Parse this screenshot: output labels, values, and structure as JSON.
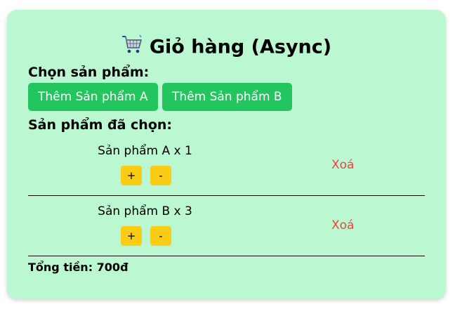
{
  "header": {
    "title": "Giỏ hàng (Async)",
    "icon": "shopping-cart-icon"
  },
  "select_label": "Chọn sản phẩm:",
  "add_buttons": [
    {
      "label": "Thêm Sản phẩm A"
    },
    {
      "label": "Thêm Sản phẩm B"
    }
  ],
  "selected_label": "Sản phẩm đã chọn:",
  "items": [
    {
      "name": "Sản phẩm A x 1",
      "plus": "+",
      "minus": "-",
      "remove": "Xoá"
    },
    {
      "name": "Sản phẩm B x 3",
      "plus": "+",
      "minus": "-",
      "remove": "Xoá"
    }
  ],
  "total": "Tổng tiền: 700đ",
  "colors": {
    "card_bg": "#bbf7d0",
    "add_button": "#22c55e",
    "qty_button": "#facc15",
    "remove_text": "#ef4444"
  }
}
